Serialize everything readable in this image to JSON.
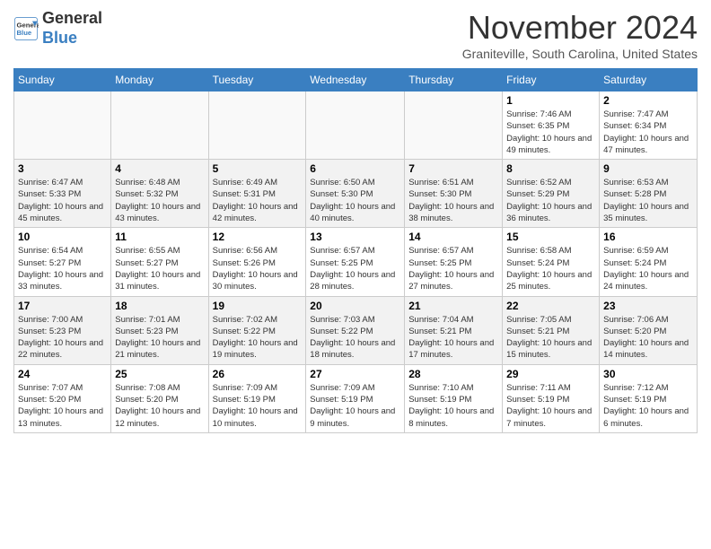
{
  "header": {
    "logo_line1": "General",
    "logo_line2": "Blue",
    "month": "November 2024",
    "location": "Graniteville, South Carolina, United States"
  },
  "days_of_week": [
    "Sunday",
    "Monday",
    "Tuesday",
    "Wednesday",
    "Thursday",
    "Friday",
    "Saturday"
  ],
  "weeks": [
    [
      {
        "day": "",
        "info": ""
      },
      {
        "day": "",
        "info": ""
      },
      {
        "day": "",
        "info": ""
      },
      {
        "day": "",
        "info": ""
      },
      {
        "day": "",
        "info": ""
      },
      {
        "day": "1",
        "info": "Sunrise: 7:46 AM\nSunset: 6:35 PM\nDaylight: 10 hours and 49 minutes."
      },
      {
        "day": "2",
        "info": "Sunrise: 7:47 AM\nSunset: 6:34 PM\nDaylight: 10 hours and 47 minutes."
      }
    ],
    [
      {
        "day": "3",
        "info": "Sunrise: 6:47 AM\nSunset: 5:33 PM\nDaylight: 10 hours and 45 minutes."
      },
      {
        "day": "4",
        "info": "Sunrise: 6:48 AM\nSunset: 5:32 PM\nDaylight: 10 hours and 43 minutes."
      },
      {
        "day": "5",
        "info": "Sunrise: 6:49 AM\nSunset: 5:31 PM\nDaylight: 10 hours and 42 minutes."
      },
      {
        "day": "6",
        "info": "Sunrise: 6:50 AM\nSunset: 5:30 PM\nDaylight: 10 hours and 40 minutes."
      },
      {
        "day": "7",
        "info": "Sunrise: 6:51 AM\nSunset: 5:30 PM\nDaylight: 10 hours and 38 minutes."
      },
      {
        "day": "8",
        "info": "Sunrise: 6:52 AM\nSunset: 5:29 PM\nDaylight: 10 hours and 36 minutes."
      },
      {
        "day": "9",
        "info": "Sunrise: 6:53 AM\nSunset: 5:28 PM\nDaylight: 10 hours and 35 minutes."
      }
    ],
    [
      {
        "day": "10",
        "info": "Sunrise: 6:54 AM\nSunset: 5:27 PM\nDaylight: 10 hours and 33 minutes."
      },
      {
        "day": "11",
        "info": "Sunrise: 6:55 AM\nSunset: 5:27 PM\nDaylight: 10 hours and 31 minutes."
      },
      {
        "day": "12",
        "info": "Sunrise: 6:56 AM\nSunset: 5:26 PM\nDaylight: 10 hours and 30 minutes."
      },
      {
        "day": "13",
        "info": "Sunrise: 6:57 AM\nSunset: 5:25 PM\nDaylight: 10 hours and 28 minutes."
      },
      {
        "day": "14",
        "info": "Sunrise: 6:57 AM\nSunset: 5:25 PM\nDaylight: 10 hours and 27 minutes."
      },
      {
        "day": "15",
        "info": "Sunrise: 6:58 AM\nSunset: 5:24 PM\nDaylight: 10 hours and 25 minutes."
      },
      {
        "day": "16",
        "info": "Sunrise: 6:59 AM\nSunset: 5:24 PM\nDaylight: 10 hours and 24 minutes."
      }
    ],
    [
      {
        "day": "17",
        "info": "Sunrise: 7:00 AM\nSunset: 5:23 PM\nDaylight: 10 hours and 22 minutes."
      },
      {
        "day": "18",
        "info": "Sunrise: 7:01 AM\nSunset: 5:23 PM\nDaylight: 10 hours and 21 minutes."
      },
      {
        "day": "19",
        "info": "Sunrise: 7:02 AM\nSunset: 5:22 PM\nDaylight: 10 hours and 19 minutes."
      },
      {
        "day": "20",
        "info": "Sunrise: 7:03 AM\nSunset: 5:22 PM\nDaylight: 10 hours and 18 minutes."
      },
      {
        "day": "21",
        "info": "Sunrise: 7:04 AM\nSunset: 5:21 PM\nDaylight: 10 hours and 17 minutes."
      },
      {
        "day": "22",
        "info": "Sunrise: 7:05 AM\nSunset: 5:21 PM\nDaylight: 10 hours and 15 minutes."
      },
      {
        "day": "23",
        "info": "Sunrise: 7:06 AM\nSunset: 5:20 PM\nDaylight: 10 hours and 14 minutes."
      }
    ],
    [
      {
        "day": "24",
        "info": "Sunrise: 7:07 AM\nSunset: 5:20 PM\nDaylight: 10 hours and 13 minutes."
      },
      {
        "day": "25",
        "info": "Sunrise: 7:08 AM\nSunset: 5:20 PM\nDaylight: 10 hours and 12 minutes."
      },
      {
        "day": "26",
        "info": "Sunrise: 7:09 AM\nSunset: 5:19 PM\nDaylight: 10 hours and 10 minutes."
      },
      {
        "day": "27",
        "info": "Sunrise: 7:09 AM\nSunset: 5:19 PM\nDaylight: 10 hours and 9 minutes."
      },
      {
        "day": "28",
        "info": "Sunrise: 7:10 AM\nSunset: 5:19 PM\nDaylight: 10 hours and 8 minutes."
      },
      {
        "day": "29",
        "info": "Sunrise: 7:11 AM\nSunset: 5:19 PM\nDaylight: 10 hours and 7 minutes."
      },
      {
        "day": "30",
        "info": "Sunrise: 7:12 AM\nSunset: 5:19 PM\nDaylight: 10 hours and 6 minutes."
      }
    ]
  ]
}
